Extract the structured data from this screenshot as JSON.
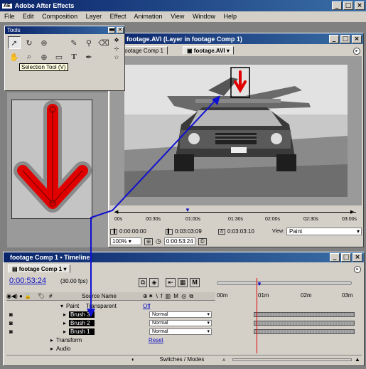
{
  "app": {
    "title": "Adobe After Effects",
    "logo": "AE",
    "menu": [
      "File",
      "Edit",
      "Composition",
      "Layer",
      "Effect",
      "Animation",
      "View",
      "Window",
      "Help"
    ]
  },
  "tools_palette": {
    "title": "Tools",
    "tooltip": "Selection Tool (V)"
  },
  "layer_window": {
    "title": "footage.AVI (Layer in footage Comp 1)",
    "tabs": [
      "footage Comp 1",
      "footage.AVI"
    ],
    "ruler_ticks": [
      "00s",
      "00:30s",
      "01:00s",
      "01:30s",
      "02:00s",
      "02:30s",
      "03:00s"
    ],
    "timecode_current": "0:00:00:00",
    "timecode_out": "0:03:03:09",
    "timecode_duration": "0:03:03:10",
    "view_mode": "Paint",
    "zoom": "100%",
    "time_display": "0:00:53:24"
  },
  "timeline": {
    "title": "footage Comp 1 • Timeline",
    "tab": "footage Comp 1",
    "current_time": "0:00:53:24",
    "fps": "(30.00 fps)",
    "column_header_source": "Source Name",
    "column_header_num": "#",
    "paint_row": "Paint",
    "paint_option": "Transparent",
    "paint_value": "Off",
    "brushes": [
      {
        "name": "Brush 3",
        "mode": "Normal"
      },
      {
        "name": "Brush 2",
        "mode": "Normal"
      },
      {
        "name": "Brush 1",
        "mode": "Normal"
      }
    ],
    "transform": "Transform",
    "transform_value": "Reset",
    "audio": "Audio",
    "switches_label": "Switches / Modes",
    "ruler_ticks": [
      "00m",
      "01m",
      "02m",
      "03m"
    ]
  },
  "colors": {
    "title_dark": "#0a246a",
    "title_light": "#3a6ea5",
    "panel": "#d4d0c8",
    "arrow_red": "#e00000",
    "annotation_blue": "#1010d0",
    "time_blue": "#1010c0"
  }
}
